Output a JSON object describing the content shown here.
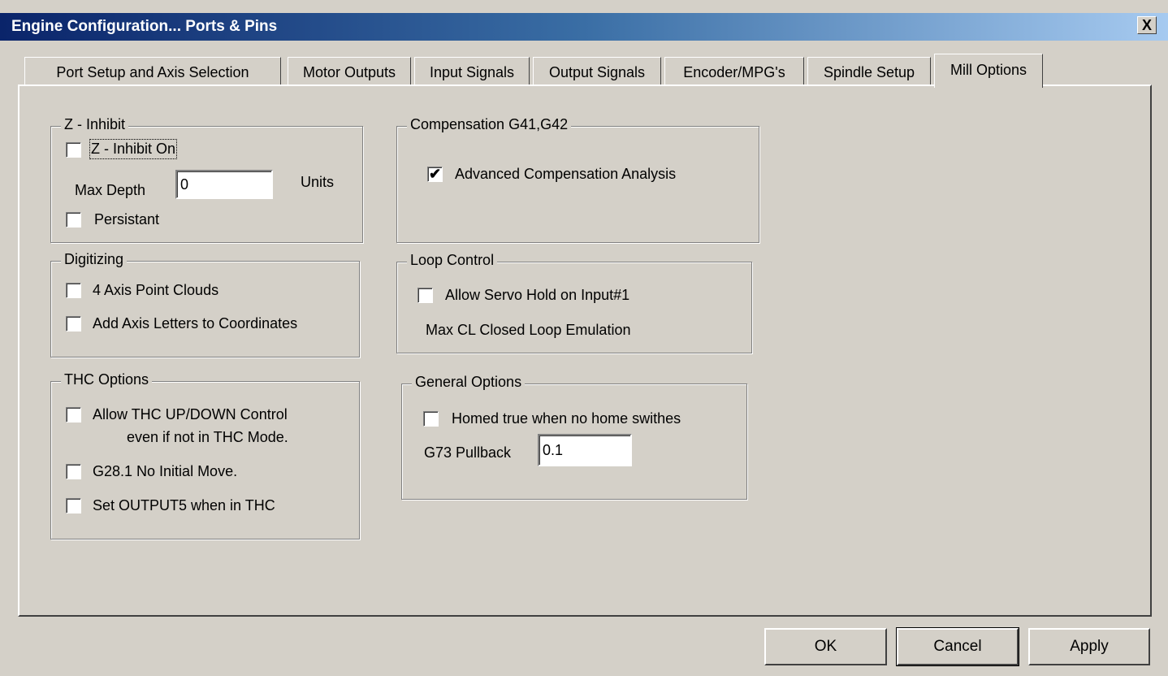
{
  "window": {
    "title": "Engine Configuration... Ports & Pins",
    "close_label": "X"
  },
  "tabs": [
    {
      "label": "Port Setup and Axis Selection"
    },
    {
      "label": "Motor Outputs"
    },
    {
      "label": "Input Signals"
    },
    {
      "label": "Output Signals"
    },
    {
      "label": "Encoder/MPG's"
    },
    {
      "label": "Spindle Setup"
    },
    {
      "label": "Mill Options"
    }
  ],
  "z_inhibit": {
    "legend": "Z - Inhibit",
    "z_inhibit_on": {
      "label": "Z - Inhibit On",
      "checked": false
    },
    "max_depth_label": "Max Depth",
    "max_depth_value": "0",
    "units_label": "Units",
    "persistant": {
      "label": "Persistant",
      "checked": false
    }
  },
  "digitizing": {
    "legend": "Digitizing",
    "point_clouds": {
      "label": "4 Axis Point Clouds",
      "checked": false
    },
    "axis_letters": {
      "label": "Add Axis Letters to Coordinates",
      "checked": false
    }
  },
  "thc": {
    "legend": "THC Options",
    "allow_updown": {
      "label_line1": "Allow THC UP/DOWN Control",
      "label_line2": "even if not in THC Mode.",
      "checked": false
    },
    "g28": {
      "label": "G28.1 No Initial Move.",
      "checked": false
    },
    "output5": {
      "label": "Set OUTPUT5 when in THC",
      "checked": false
    }
  },
  "compensation": {
    "legend": "Compensation G41,G42",
    "advanced": {
      "label": "Advanced Compensation Analysis",
      "checked": true,
      "mark": "✔"
    }
  },
  "loop_control": {
    "legend": "Loop Control",
    "servo_hold": {
      "label": "Allow Servo Hold on Input#1",
      "checked": false
    },
    "max_cl_label": "Max CL Closed Loop Emulation"
  },
  "general": {
    "legend": "General Options",
    "homed_true": {
      "label": "Homed true when no home swithes",
      "checked": false
    },
    "g73_label": "G73 Pullback",
    "g73_value": "0.1"
  },
  "buttons": {
    "ok": "OK",
    "cancel": "Cancel",
    "apply": "Apply"
  }
}
